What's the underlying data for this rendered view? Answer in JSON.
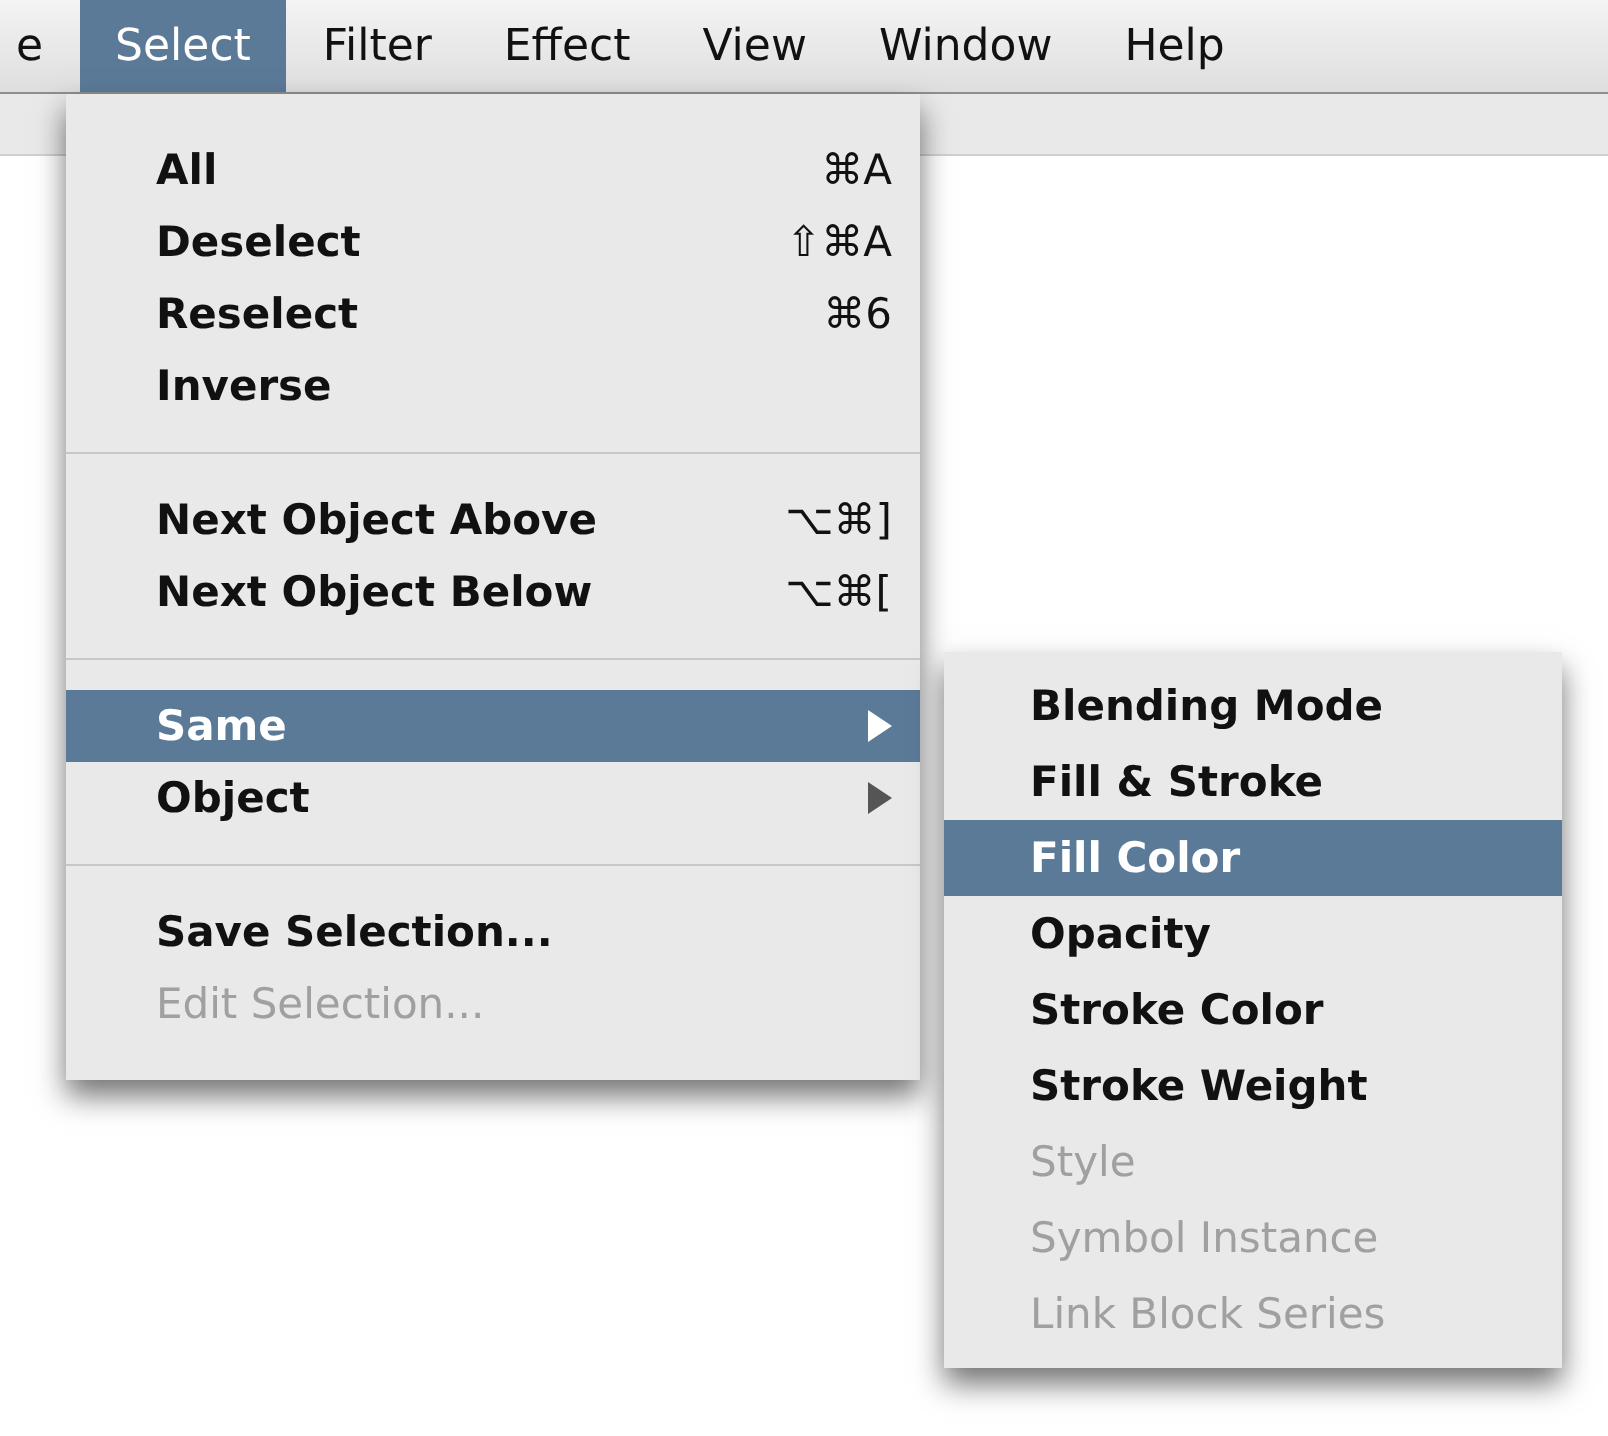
{
  "menu_bar": [
    {
      "label": "e",
      "selected": false
    },
    {
      "label": "Select",
      "selected": true
    },
    {
      "label": "Filter",
      "selected": false
    },
    {
      "label": "Effect",
      "selected": false
    },
    {
      "label": "View",
      "selected": false
    },
    {
      "label": "Window",
      "selected": false
    },
    {
      "label": "Help",
      "selected": false
    }
  ],
  "menu": {
    "groups": [
      [
        {
          "label": "All",
          "shortcut": "⌘A",
          "submenu": false,
          "selected": false,
          "disabled": false
        },
        {
          "label": "Deselect",
          "shortcut": "⇧⌘A",
          "submenu": false,
          "selected": false,
          "disabled": false
        },
        {
          "label": "Reselect",
          "shortcut": "⌘6",
          "submenu": false,
          "selected": false,
          "disabled": false
        },
        {
          "label": "Inverse",
          "submenu": false,
          "selected": false,
          "disabled": false
        }
      ],
      [
        {
          "label": "Next Object Above",
          "shortcut": "⌥⌘]",
          "submenu": false,
          "selected": false,
          "disabled": false
        },
        {
          "label": "Next Object Below",
          "shortcut": "⌥⌘[",
          "submenu": false,
          "selected": false,
          "disabled": false
        }
      ],
      [
        {
          "label": "Same",
          "submenu": true,
          "selected": true,
          "disabled": false
        },
        {
          "label": "Object",
          "submenu": true,
          "selected": false,
          "disabled": false
        }
      ],
      [
        {
          "label": "Save Selection...",
          "submenu": false,
          "selected": false,
          "disabled": false
        },
        {
          "label": "Edit Selection...",
          "submenu": false,
          "selected": false,
          "disabled": true
        }
      ]
    ]
  },
  "submenu": {
    "items": [
      {
        "label": "Blending Mode",
        "selected": false,
        "disabled": false
      },
      {
        "label": "Fill & Stroke",
        "selected": false,
        "disabled": false
      },
      {
        "label": "Fill Color",
        "selected": true,
        "disabled": false
      },
      {
        "label": "Opacity",
        "selected": false,
        "disabled": false
      },
      {
        "label": "Stroke Color",
        "selected": false,
        "disabled": false
      },
      {
        "label": "Stroke Weight",
        "selected": false,
        "disabled": false
      },
      {
        "label": "Style",
        "selected": false,
        "disabled": true
      },
      {
        "label": "Symbol Instance",
        "selected": false,
        "disabled": true
      },
      {
        "label": "Link Block Series",
        "selected": false,
        "disabled": true
      }
    ]
  }
}
